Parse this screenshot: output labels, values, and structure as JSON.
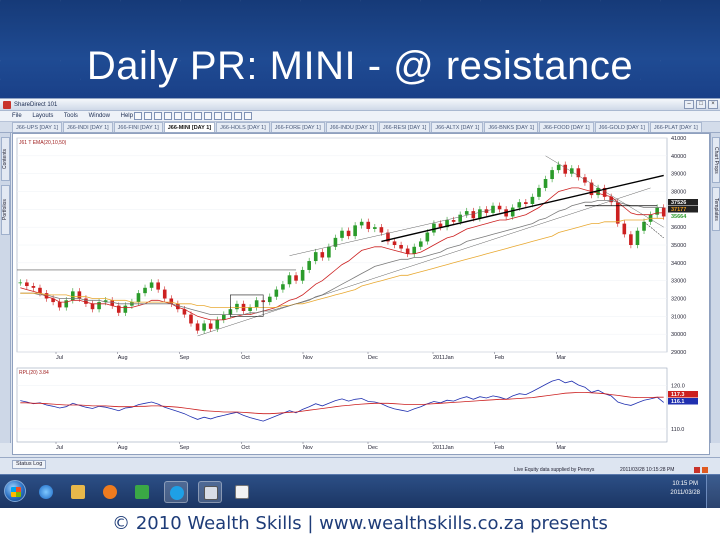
{
  "slide": {
    "title": "Daily PR: MINI - @ resistance",
    "footer": "© 2010 Wealth Skills | www.wealthskills.co.za presents"
  },
  "app": {
    "window_title": "ShareDirect 101",
    "menu": [
      "File",
      "Layouts",
      "Tools",
      "Window",
      "Help"
    ],
    "tabs": [
      {
        "label": "J66-UPS [DAY 1]",
        "active": false
      },
      {
        "label": "J66-INDI [DAY 1]",
        "active": false
      },
      {
        "label": "J66-FINI [DAY 1]",
        "active": false
      },
      {
        "label": "J66-MINI [DAY 1]",
        "active": true
      },
      {
        "label": "J66-HOLS [DAY 1]",
        "active": false
      },
      {
        "label": "J66-FORE [DAY 1]",
        "active": false
      },
      {
        "label": "J66-INDU [DAY 1]",
        "active": false
      },
      {
        "label": "J66-RESI [DAY 1]",
        "active": false
      },
      {
        "label": "J66-ALTX [DAY 1]",
        "active": false
      },
      {
        "label": "J66-BNKS [DAY 1]",
        "active": false
      },
      {
        "label": "J66-FOOD [DAY 1]",
        "active": false
      },
      {
        "label": "J66-GOLD [DAY 1]",
        "active": false
      },
      {
        "label": "J66-PLAT [DAY 1]",
        "active": false
      }
    ],
    "left_panel_tabs": [
      "Contents",
      "Portfolios"
    ],
    "right_panel_tabs": [
      "Chart Props",
      "Templates"
    ],
    "status_log": "Status Log",
    "status_feed": "Live Equity data supplied by Pennys",
    "status_date": "2011/03/28 10:15:28 PM"
  },
  "chart_data": [
    {
      "type": "line",
      "panel": "price",
      "legend_text": "J61 T EMA(20,10,50)",
      "x_tick_labels": [
        "Jul",
        "Aug",
        "Sep",
        "Oct",
        "Nov",
        "Dec",
        "2011Jan",
        "Feb",
        "Mar"
      ],
      "y_tick_labels": [
        "41000",
        "40000",
        "39000",
        "38000",
        "37000",
        "36000",
        "35000",
        "34000",
        "33000",
        "32000",
        "31000",
        "30000",
        "29000"
      ],
      "ylim": [
        29000,
        41000
      ],
      "price_labels": [
        {
          "text": "37526",
          "color": "#ffffff"
        },
        {
          "text": "37177",
          "color": "#f0a020"
        },
        {
          "text": "35664",
          "color": "#2a9b2a"
        }
      ],
      "series": [
        {
          "name": "",
          "color": "#000000",
          "values": [
            32900,
            32700,
            32600,
            32300,
            32000,
            31800,
            31500,
            31900,
            32400,
            32000,
            31700,
            31400,
            31800,
            31900,
            31600,
            31200,
            31600,
            31800,
            32300,
            32600,
            32900,
            32500,
            32000,
            31700,
            31400,
            31100,
            30600,
            30200,
            30600,
            30300,
            30800,
            31100,
            31400,
            31700,
            31300,
            31500,
            31900,
            31800,
            32100,
            32500,
            32800,
            33300,
            33000,
            33600,
            34100,
            34600,
            34300,
            34900,
            35400,
            35800,
            35500,
            36100,
            36300,
            35900,
            36000,
            35700,
            35200,
            35000,
            34800,
            34500,
            34900,
            35200,
            35700,
            36200,
            36000,
            36400,
            36300,
            36700,
            36900,
            36500,
            37000,
            36800,
            37200,
            37000,
            36600,
            37100,
            37400,
            37300,
            37700,
            38200,
            38700,
            39200,
            39500,
            39000,
            39300,
            38800,
            38500,
            37800,
            38200,
            37700,
            37400,
            36200,
            35600,
            35000,
            35800,
            36300,
            36700,
            37100,
            36600
          ]
        },
        {
          "name": "",
          "color": "#cc2020",
          "values": [
            32600,
            32500,
            32400,
            32300,
            32100,
            32000,
            31800,
            31800,
            31900,
            31900,
            31800,
            31700,
            31700,
            31700,
            31600,
            31500,
            31500,
            31500,
            31600,
            31700,
            31900,
            31900,
            31800,
            31700,
            31500,
            31400,
            31200,
            31000,
            30900,
            30800,
            30800,
            30800,
            30900,
            31000,
            31100,
            31100,
            31200,
            31300,
            31400,
            31500,
            31700,
            31900,
            32000,
            32200,
            32500,
            32800,
            33000,
            33300,
            33600,
            33900,
            34100,
            34400,
            34700,
            34800,
            34900,
            34900,
            34800,
            34700,
            34600,
            34500,
            34500,
            34600,
            34800,
            35000,
            35200,
            35400,
            35500,
            35700,
            35900,
            36000,
            36100,
            36200,
            36300,
            36400,
            36400,
            36500,
            36600,
            36700,
            36900,
            37100,
            37400,
            37700,
            38000,
            38100,
            38200,
            38200,
            38100,
            38000,
            37900,
            37800,
            37700,
            37400,
            37100,
            36800,
            36700,
            36700,
            36700,
            36800,
            36800
          ]
        },
        {
          "name": "",
          "color": "#7a7a7a",
          "values": [
            32300,
            32300,
            32300,
            32200,
            32200,
            32100,
            32000,
            32000,
            32000,
            32000,
            31900,
            31900,
            31900,
            31800,
            31800,
            31700,
            31700,
            31700,
            31700,
            31700,
            31700,
            31700,
            31700,
            31700,
            31600,
            31500,
            31400,
            31300,
            31200,
            31100,
            31100,
            31100,
            31100,
            31100,
            31100,
            31200,
            31200,
            31300,
            31300,
            31400,
            31500,
            31600,
            31700,
            31800,
            31900,
            32100,
            32200,
            32400,
            32600,
            32800,
            33000,
            33200,
            33400,
            33600,
            33800,
            33900,
            34000,
            34100,
            34200,
            34200,
            34300,
            34300,
            34400,
            34500,
            34600,
            34800,
            34900,
            35000,
            35200,
            35300,
            35400,
            35500,
            35600,
            35700,
            35800,
            35900,
            36000,
            36100,
            36200,
            36400,
            36500,
            36700,
            36900,
            37000,
            37200,
            37300,
            37400,
            37400,
            37500,
            37500,
            37500,
            37400,
            37300,
            37200,
            37200,
            37100,
            37100,
            37100,
            37100
          ]
        },
        {
          "name": "",
          "color": "#e8a830",
          "values": [
            32300,
            32300,
            32300,
            32300,
            32200,
            32200,
            32200,
            32200,
            32100,
            32100,
            32100,
            32000,
            32000,
            32000,
            31900,
            31900,
            31900,
            31800,
            31800,
            31800,
            31800,
            31800,
            31800,
            31800,
            31700,
            31700,
            31700,
            31600,
            31600,
            31500,
            31500,
            31500,
            31500,
            31500,
            31500,
            31500,
            31500,
            31500,
            31500,
            31500,
            31600,
            31600,
            31700,
            31700,
            31800,
            31900,
            32000,
            32100,
            32200,
            32300,
            32400,
            32500,
            32700,
            32800,
            32900,
            33000,
            33100,
            33200,
            33300,
            33300,
            33400,
            33500,
            33600,
            33700,
            33800,
            33900,
            34000,
            34100,
            34200,
            34300,
            34400,
            34500,
            34600,
            34700,
            34800,
            34900,
            35000,
            35100,
            35200,
            35300,
            35400,
            35500,
            35700,
            35800,
            35900,
            36000,
            36100,
            36200,
            36200,
            36300,
            36300,
            36300,
            36400,
            36400,
            36400,
            36400,
            36500,
            36500,
            36500
          ]
        }
      ]
    },
    {
      "type": "line",
      "panel": "rsi",
      "legend_text": "RPL(20) 3.84",
      "x_tick_labels": [
        "Jul",
        "Aug",
        "Sep",
        "Oct",
        "Nov",
        "Dec",
        "2011Jan",
        "Feb",
        "Mar"
      ],
      "y_tick_labels": [
        "120.0",
        "110.0"
      ],
      "ylim": [
        107,
        124
      ],
      "price_labels": [
        {
          "text": "117.3",
          "color": "#cc2020"
        },
        {
          "text": "116.1",
          "color": "#2030b0"
        }
      ],
      "series": [
        {
          "name": "",
          "color": "#2030b0",
          "values": [
            116.5,
            116.2,
            115.8,
            116.0,
            115.5,
            115.2,
            114.8,
            115.1,
            115.9,
            115.4,
            115.0,
            114.7,
            115.2,
            115.0,
            114.6,
            114.2,
            114.8,
            115.0,
            115.6,
            115.9,
            116.2,
            115.7,
            115.0,
            114.5,
            114.0,
            113.5,
            112.8,
            112.2,
            112.7,
            112.3,
            112.8,
            113.1,
            113.5,
            113.8,
            113.1,
            112.6,
            112.2,
            111.8,
            112.4,
            113.0,
            113.6,
            114.2,
            113.7,
            114.5,
            115.1,
            115.8,
            115.3,
            115.9,
            116.5,
            116.9,
            116.4,
            116.8,
            117.0,
            116.3,
            116.2,
            115.8,
            115.1,
            114.6,
            114.3,
            114.0,
            114.6,
            115.1,
            115.8,
            116.3,
            116.0,
            116.6,
            116.4,
            117.0,
            117.4,
            116.8,
            117.4,
            117.1,
            117.6,
            117.3,
            116.8,
            117.6,
            118.1,
            117.9,
            118.6,
            119.4,
            120.2,
            121.0,
            121.4,
            120.6,
            121.0,
            120.1,
            119.6,
            118.4,
            118.9,
            118.1,
            117.6,
            116.2,
            115.7,
            115.4,
            116.0,
            116.6,
            116.9,
            117.3,
            116.1
          ]
        },
        {
          "name": "",
          "color": "#cc2020",
          "values": [
            116.0,
            116.0,
            115.9,
            115.9,
            115.8,
            115.7,
            115.6,
            115.5,
            115.5,
            115.5,
            115.4,
            115.3,
            115.3,
            115.3,
            115.2,
            115.1,
            115.1,
            115.1,
            115.2,
            115.2,
            115.3,
            115.3,
            115.2,
            115.1,
            115.0,
            114.8,
            114.6,
            114.4,
            114.2,
            114.1,
            114.0,
            113.9,
            113.9,
            113.9,
            113.8,
            113.7,
            113.6,
            113.5,
            113.5,
            113.6,
            113.7,
            113.8,
            113.9,
            114.1,
            114.3,
            114.5,
            114.7,
            114.9,
            115.1,
            115.3,
            115.4,
            115.6,
            115.7,
            115.8,
            115.9,
            115.9,
            115.9,
            115.8,
            115.7,
            115.6,
            115.6,
            115.6,
            115.7,
            115.8,
            115.9,
            116.0,
            116.1,
            116.2,
            116.3,
            116.4,
            116.5,
            116.6,
            116.7,
            116.8,
            116.8,
            116.9,
            117.0,
            117.1,
            117.2,
            117.4,
            117.6,
            117.8,
            118.0,
            118.2,
            118.3,
            118.4,
            118.4,
            118.3,
            118.2,
            118.1,
            117.9,
            117.7,
            117.5,
            117.3,
            117.2,
            117.2,
            117.2,
            117.3,
            117.3
          ]
        }
      ]
    }
  ],
  "taskbar": {
    "time": "10:15 PM",
    "date": "2011/03/28"
  },
  "colors": {
    "slide_bg": "#1f4b93",
    "up_candle": "#2a9b2a",
    "down_candle": "#cc2020"
  }
}
